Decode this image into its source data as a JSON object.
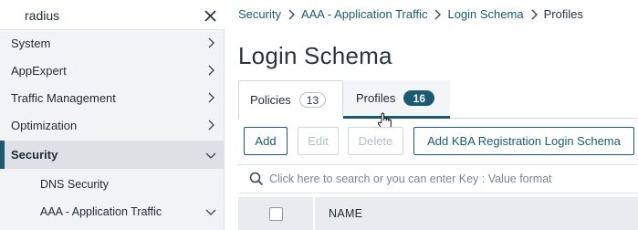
{
  "sidebar": {
    "search_value": "radius",
    "items": [
      {
        "label": "System",
        "expanded": false
      },
      {
        "label": "AppExpert",
        "expanded": false
      },
      {
        "label": "Traffic Management",
        "expanded": false
      },
      {
        "label": "Optimization",
        "expanded": false
      },
      {
        "label": "Security",
        "expanded": true,
        "active": true
      },
      {
        "label": "DNS Security",
        "sub": true
      },
      {
        "label": "AAA - Application Traffic",
        "sub": true,
        "expanded": true
      }
    ]
  },
  "breadcrumb": {
    "items": [
      "Security",
      "AAA - Application Traffic",
      "Login Schema",
      "Profiles"
    ]
  },
  "page": {
    "title": "Login Schema"
  },
  "tabs": [
    {
      "label": "Policies",
      "count": "13",
      "active": false
    },
    {
      "label": "Profiles",
      "count": "16",
      "active": true
    }
  ],
  "toolbar": {
    "add": "Add",
    "edit": "Edit",
    "delete": "Delete",
    "add_kba": "Add KBA Registration Login Schema"
  },
  "table": {
    "search_placeholder": "Click here to search or you can enter Key : Value format",
    "columns": [
      "NAME"
    ]
  },
  "colors": {
    "accent": "#1b5a72",
    "sidebar_bg": "#f2f3f5",
    "disabled": "#b5bec5"
  },
  "icons": [
    "close-icon",
    "chevron-right-icon",
    "chevron-down-icon",
    "search-icon",
    "hand-cursor-icon"
  ]
}
